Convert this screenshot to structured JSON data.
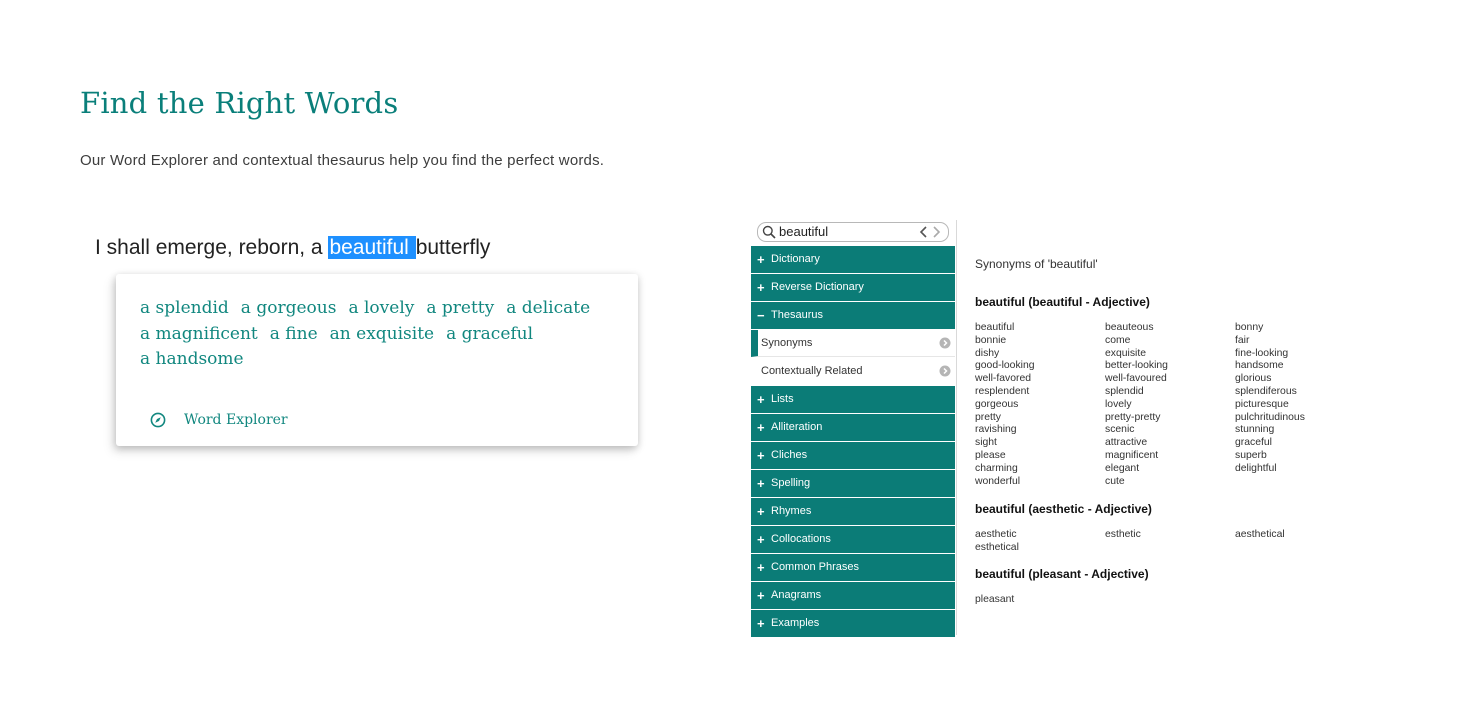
{
  "heading": "Find the Right Words",
  "subheading": "Our Word Explorer and contextual thesaurus help you find the perfect words.",
  "demo": {
    "sentence_before": "I shall emerge, reborn, a ",
    "sentence_highlight": "beautiful ",
    "sentence_after": "butterfly",
    "suggestions": [
      "a splendid",
      "a gorgeous",
      "a lovely",
      "a pretty",
      "a delicate",
      "a magnificent",
      "a fine",
      "an exquisite",
      "a graceful",
      "a handsome"
    ],
    "footer_icon": "compass-icon",
    "footer_label": "Word Explorer",
    "accent_color": "#11877f",
    "highlight_color": "#1e90ff"
  },
  "app": {
    "search_value": "beautiful",
    "nav": [
      {
        "label": "Dictionary",
        "sign": "+"
      },
      {
        "label": "Reverse Dictionary",
        "sign": "+"
      },
      {
        "label": "Thesaurus",
        "sign": "−"
      }
    ],
    "subnav": [
      {
        "label": "Synonyms",
        "active": true
      },
      {
        "label": "Contextually Related",
        "active": false
      }
    ],
    "nav_more": [
      {
        "label": "Lists",
        "sign": "+"
      },
      {
        "label": "Alliteration",
        "sign": "+"
      },
      {
        "label": "Cliches",
        "sign": "+"
      },
      {
        "label": "Spelling",
        "sign": "+"
      },
      {
        "label": "Rhymes",
        "sign": "+"
      },
      {
        "label": "Collocations",
        "sign": "+"
      },
      {
        "label": "Common Phrases",
        "sign": "+"
      },
      {
        "label": "Anagrams",
        "sign": "+"
      },
      {
        "label": "Examples",
        "sign": "+"
      }
    ],
    "nav_color": "#0b7c77",
    "content_title": "Synonyms of 'beautiful'",
    "groups": [
      {
        "head": "beautiful (beautiful - Adjective)",
        "words": [
          "beautiful",
          "beauteous",
          "bonny",
          "bonnie",
          "come",
          "fair",
          "dishy",
          "exquisite",
          "fine-looking",
          "good-looking",
          "better-looking",
          "handsome",
          "well-favored",
          "well-favoured",
          "glorious",
          "resplendent",
          "splendid",
          "splendiferous",
          "gorgeous",
          "lovely",
          "picturesque",
          "pretty",
          "pretty-pretty",
          "pulchritudinous",
          "ravishing",
          "scenic",
          "stunning",
          "sight",
          "attractive",
          "graceful",
          "please",
          "magnificent",
          "superb",
          "charming",
          "elegant",
          "delightful",
          "wonderful",
          "cute"
        ]
      },
      {
        "head": "beautiful (aesthetic - Adjective)",
        "words": [
          "aesthetic",
          "esthetic",
          "aesthetical",
          "esthetical"
        ]
      },
      {
        "head": "beautiful (pleasant - Adjective)",
        "words": [
          "pleasant"
        ]
      }
    ]
  }
}
